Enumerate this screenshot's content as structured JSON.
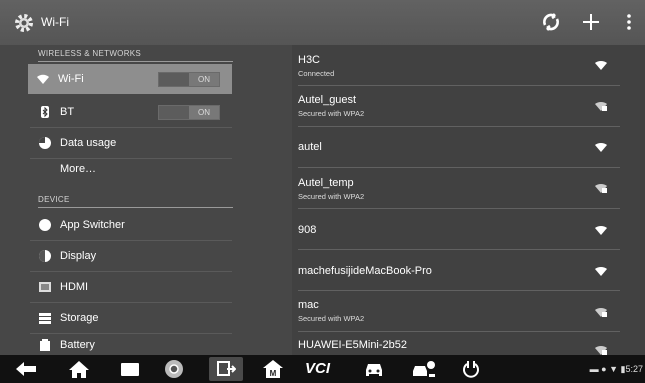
{
  "topbar": {
    "title": "Wi-Fi",
    "actions": [
      "sync-icon",
      "add-icon",
      "overflow-menu-icon"
    ]
  },
  "settings": {
    "wireless_header": "WIRELESS & NETWORKS",
    "device_header": "DEVICE",
    "items": [
      {
        "label": "Wi-Fi",
        "icon": "wifi-icon",
        "toggle": "ON"
      },
      {
        "label": "BT",
        "icon": "bluetooth-icon",
        "toggle": "ON"
      },
      {
        "label": "Data usage",
        "icon": "data-usage-icon"
      },
      {
        "label": "More…"
      },
      {
        "label": "App Switcher",
        "icon": "app-switcher-icon"
      },
      {
        "label": "Display",
        "icon": "display-icon"
      },
      {
        "label": "HDMI",
        "icon": "hdmi-icon"
      },
      {
        "label": "Storage",
        "icon": "storage-icon"
      },
      {
        "label": "Battery",
        "icon": "battery-icon"
      }
    ]
  },
  "networks": [
    {
      "name": "H3C",
      "status": "Connected",
      "secured": false
    },
    {
      "name": "Autel_guest",
      "status": "Secured with WPA2",
      "secured": true
    },
    {
      "name": "autel",
      "status": "",
      "secured": false
    },
    {
      "name": "Autel_temp",
      "status": "Secured with WPA2",
      "secured": true
    },
    {
      "name": "908",
      "status": "",
      "secured": false
    },
    {
      "name": "machefusijideMacBook-Pro",
      "status": "",
      "secured": false
    },
    {
      "name": "mac",
      "status": "Secured with WPA2",
      "secured": true
    },
    {
      "name": "HUAWEI-E5Mini-2b52",
      "status": "",
      "secured": true
    }
  ],
  "navbar": {
    "buttons": [
      "back-icon",
      "home-icon",
      "recents-icon",
      "chrome-icon",
      "screen-switch-icon",
      "maxifix-icon",
      "vci-icon",
      "car-icon",
      "service-car-icon",
      "power-icon"
    ],
    "vci_label": "VCI",
    "time": "5:27"
  }
}
